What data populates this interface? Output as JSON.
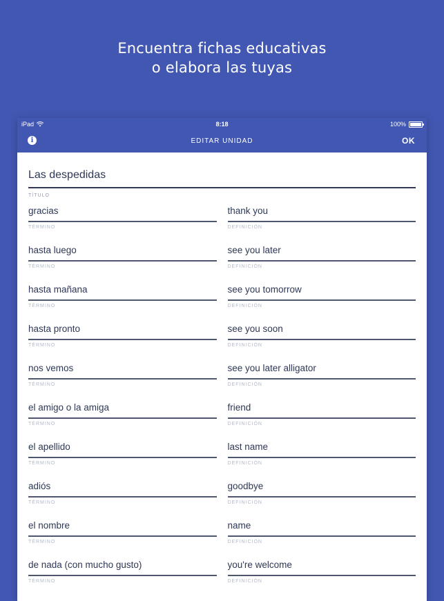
{
  "headline": {
    "line1": "Encuentra fichas educativas",
    "line2": "o elabora las tuyas"
  },
  "status_bar": {
    "device": "iPad",
    "time": "8:18",
    "battery": "100%"
  },
  "nav": {
    "title": "EDITAR UNIDAD",
    "ok_label": "OK"
  },
  "set": {
    "title": "Las despedidas",
    "title_label": "TÍTULO"
  },
  "term_label": "TÉRMINO",
  "definition_label": "DEFINICIÓN",
  "cards": [
    {
      "term": "gracias",
      "definition": "thank you"
    },
    {
      "term": "hasta luego",
      "definition": "see you later"
    },
    {
      "term": "hasta mañana",
      "definition": "see you tomorrow"
    },
    {
      "term": "hasta pronto",
      "definition": "see you soon"
    },
    {
      "term": "nos vemos",
      "definition": "see you later alligator"
    },
    {
      "term": "el amigo o la amiga",
      "definition": "friend"
    },
    {
      "term": "el apellido",
      "definition": "last name"
    },
    {
      "term": "adiós",
      "definition": "goodbye"
    },
    {
      "term": "el nombre",
      "definition": "name"
    },
    {
      "term": "de nada (con mucho gusto)",
      "definition": "you're welcome"
    }
  ]
}
